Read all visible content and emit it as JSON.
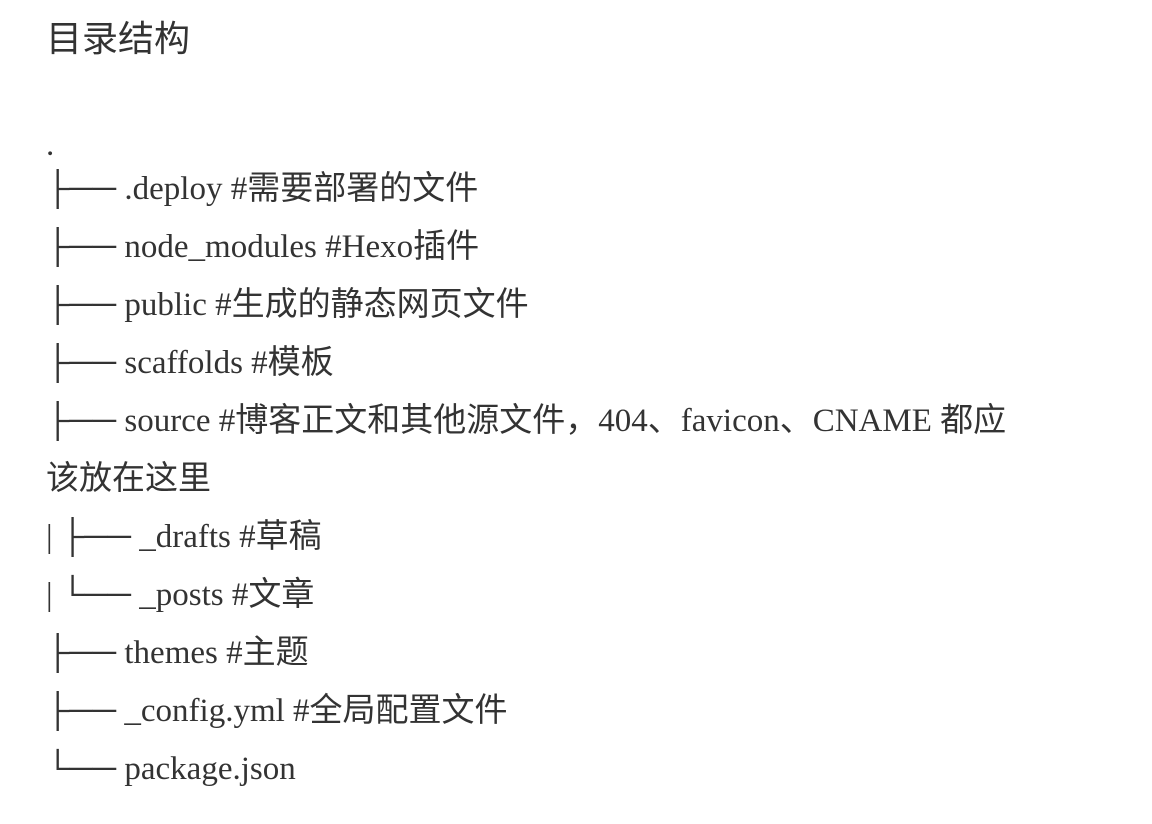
{
  "heading": "目录结构",
  "tree": {
    "lines": [
      ".",
      " ├── .deploy #需要部署的文件",
      " ├── node_modules #Hexo插件",
      " ├── public #生成的静态网页文件",
      " ├── scaffolds #模板",
      " ├── source #博客正文和其他源文件，404、favicon、CNAME 都应",
      "该放在这里",
      "| ├── _drafts #草稿",
      "| └── _posts #文章",
      " ├── themes #主题",
      " ├── _config.yml #全局配置文件",
      " └── package.json"
    ]
  }
}
